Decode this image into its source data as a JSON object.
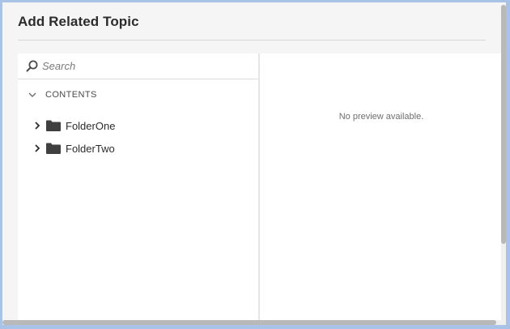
{
  "dialog": {
    "title": "Add Related Topic"
  },
  "search": {
    "placeholder": "Search",
    "value": ""
  },
  "tree": {
    "header": "CONTENTS",
    "items": [
      {
        "label": "FolderOne",
        "icon": "folder-icon"
      },
      {
        "label": "FolderTwo",
        "icon": "folder-icon"
      }
    ]
  },
  "preview": {
    "message": "No preview available."
  },
  "colors": {
    "frame": "#a9c3e6",
    "dialog_bg": "#f5f5f5",
    "panel_bg": "#ffffff",
    "text": "#2c2c2c",
    "muted_text": "#6e6e6e"
  }
}
